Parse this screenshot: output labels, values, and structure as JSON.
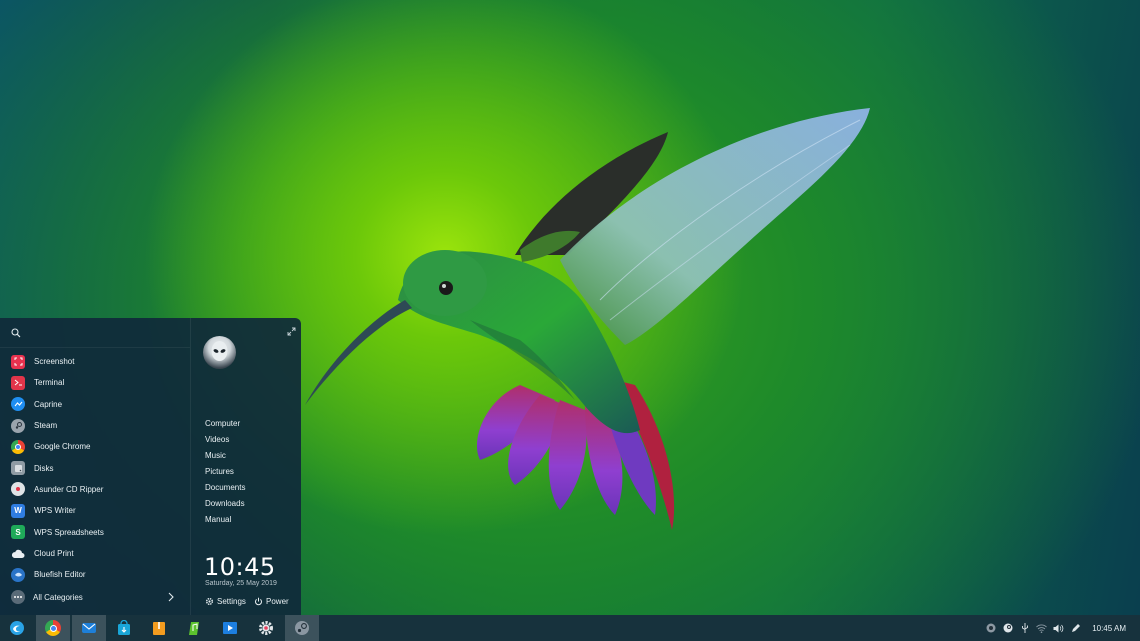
{
  "desktop": {
    "wallpaper_icon": "hummingbird-wallpaper"
  },
  "start_menu": {
    "search": {
      "placeholder": "",
      "value": "",
      "icon": "search-icon"
    },
    "apps": [
      {
        "label": "Screenshot",
        "icon": "screenshot-icon",
        "color": "#e8324f"
      },
      {
        "label": "Terminal",
        "icon": "terminal-icon",
        "color": "#e2354a"
      },
      {
        "label": "Caprine",
        "icon": "caprine-icon",
        "color": "#1f8ef1"
      },
      {
        "label": "Steam",
        "icon": "steam-icon",
        "color": "#9aa4ad"
      },
      {
        "label": "Google Chrome",
        "icon": "chrome-icon",
        "color": "#e94235"
      },
      {
        "label": "Disks",
        "icon": "disks-icon",
        "color": "#8f9ba4"
      },
      {
        "label": "Asunder CD Ripper",
        "icon": "cd-ripper-icon",
        "color": "#dfe3e6"
      },
      {
        "label": "WPS Writer",
        "icon": "wps-writer-icon",
        "color": "#2f7de1"
      },
      {
        "label": "WPS Spreadsheets",
        "icon": "wps-spreadsheets-icon",
        "color": "#1faa59"
      },
      {
        "label": "Cloud Print",
        "icon": "cloud-print-icon",
        "color": "#e9eef2"
      },
      {
        "label": "Bluefish Editor",
        "icon": "bluefish-icon",
        "color": "#2a74c8"
      }
    ],
    "all_categories": "All Categories",
    "places": [
      "Computer",
      "Videos",
      "Music",
      "Pictures",
      "Documents",
      "Downloads",
      "Manual"
    ],
    "clock": {
      "time": "10:45",
      "date": "Saturday, 25 May 2019"
    },
    "settings_label": "Settings",
    "power_label": "Power"
  },
  "taskbar": {
    "launcher_icon": "deepin-launcher-icon",
    "apps": [
      {
        "name": "chrome",
        "icon": "chrome-icon",
        "active": true
      },
      {
        "name": "mail",
        "icon": "mail-icon",
        "active": true
      },
      {
        "name": "app-store",
        "icon": "app-store-icon",
        "active": false
      },
      {
        "name": "archive-manager",
        "icon": "archive-icon",
        "active": false
      },
      {
        "name": "music",
        "icon": "music-icon",
        "active": false
      },
      {
        "name": "movie",
        "icon": "movie-icon",
        "active": false
      },
      {
        "name": "settings",
        "icon": "gear-icon",
        "active": false
      },
      {
        "name": "steam",
        "icon": "steam-icon",
        "active": true
      }
    ],
    "tray": [
      "app-tray-icon",
      "steam-tray-icon",
      "usb-icon",
      "wifi-icon",
      "volume-icon",
      "pen-icon"
    ],
    "clock": "10:45 AM"
  },
  "colors": {
    "menu_bg": "#102a3a",
    "taskbar_bg": "#17323d",
    "accent_green": "#6cc80a"
  }
}
